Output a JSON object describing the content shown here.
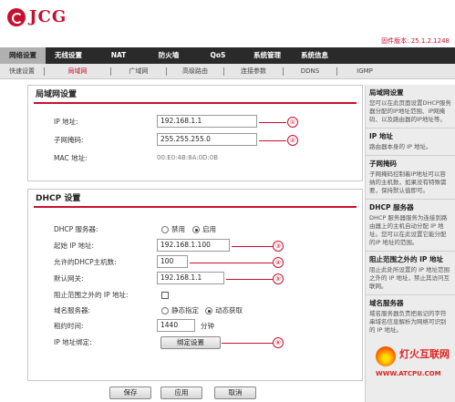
{
  "brand": {
    "name": "JCG"
  },
  "firmware": "固件版本: 25.1.2.1248",
  "mainnav": [
    {
      "label": "网络设置",
      "active": true
    },
    {
      "label": "无线设置",
      "active": false
    },
    {
      "label": "NAT",
      "active": false
    },
    {
      "label": "防火墙",
      "active": false
    },
    {
      "label": "QoS",
      "active": false
    },
    {
      "label": "系统管理",
      "active": false
    },
    {
      "label": "系统信息",
      "active": false
    }
  ],
  "subnav": [
    {
      "label": "快速设置",
      "active": false
    },
    {
      "label": "局域网",
      "active": true
    },
    {
      "label": "广域网",
      "active": false
    },
    {
      "label": "高级路由",
      "active": false
    },
    {
      "label": "连接参数",
      "active": false
    },
    {
      "label": "DDNS",
      "active": false
    },
    {
      "label": "IGMP",
      "active": false
    }
  ],
  "lan": {
    "title": "局域网设置",
    "ip_label": "IP 地址:",
    "ip_value": "192.168.1.1",
    "mask_label": "子网掩码:",
    "mask_value": "255.255.255.0",
    "mac_label": "MAC 地址:",
    "mac_value": "00:E0:4B:8A:0D:0B"
  },
  "dhcp": {
    "title": "DHCP 设置",
    "server_label": "DHCP 服务器:",
    "server_opt_off": "禁用",
    "server_opt_on": "启用",
    "server_selected": "启用",
    "start_label": "起始 IP 地址:",
    "start_value": "192.168.1.100",
    "max_label": "允许的DHCP主机数:",
    "max_value": "100",
    "gateway_label": "默认网关:",
    "gateway_value": "192.168.1.1",
    "block_label": "阻止范围之外的 IP 地址:",
    "block_checked": false,
    "dns_label": "域名服务器:",
    "dns_opt_static": "静态指定",
    "dns_opt_auto": "动态获取",
    "dns_selected": "动态获取",
    "lease_label": "租约时间:",
    "lease_value": "1440",
    "lease_unit": "分钟",
    "bind_label": "IP 地址绑定:",
    "bind_button": "绑定设置"
  },
  "markers": [
    "①",
    "②",
    "③",
    "④",
    "⑤",
    "⑥"
  ],
  "buttons": {
    "save": "保存",
    "apply": "应用",
    "cancel": "取消"
  },
  "help": [
    {
      "title": "局域网设置",
      "text": "您可以在此页面设置DHCP服务器分配的IP地址范围、IP网掩码、以及路由器的IP地址等。"
    },
    {
      "title": "IP 地址",
      "text": "路由器本身的 IP 地址。"
    },
    {
      "title": "子网掩码",
      "text": "子网掩码控制着IP地址可以容纳的主机数，如果没有特殊需要，保持默认值即可。"
    },
    {
      "title": "DHCP 服务器",
      "text": "DHCP 服务器服务为连接到路由器上的主机自动分配 IP 地址。您可以在此设置它能分配的IP 地址的范围。"
    },
    {
      "title": "阻止范围之外的 IP 地址",
      "text": "阻止此处所设置的 IP 地址范围之外的 IP 地址，禁止其访问互联网。"
    },
    {
      "title": "域名服务器",
      "text": "域名服务器负责把易记的字符串域名信息解析为网络可识别的 IP 地址。"
    }
  ],
  "watermark": {
    "name": "灯火互联网",
    "url": "WWW.ATCPU.COM"
  },
  "colors": {
    "accent": "#c8102e",
    "nav_bg": "#2a2a2a"
  }
}
